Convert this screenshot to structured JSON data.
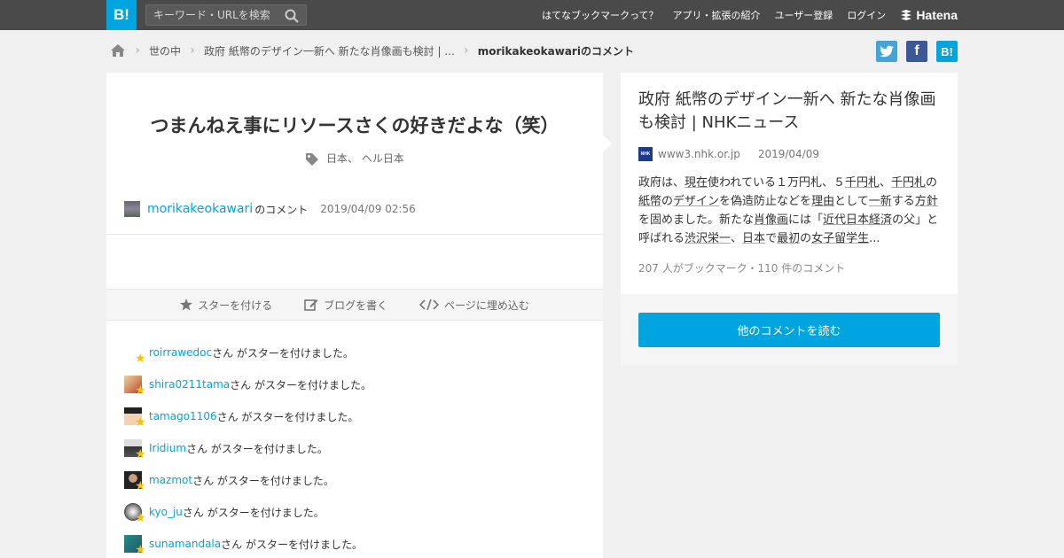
{
  "header": {
    "logo": "B!",
    "search_placeholder": "キーワード・URLを検索",
    "nav": [
      "はてなブックマークって？",
      "アプリ・拡張の紹介",
      "ユーザー登録",
      "ログイン"
    ],
    "brand": "Hatena"
  },
  "breadcrumb": {
    "items": [
      "世の中",
      "政府 紙幣のデザイン一新へ 新たな肖像画も検討 | ..."
    ],
    "current": "morikakeokawariのコメント"
  },
  "share": {
    "twitter": "t",
    "facebook": "f",
    "hatena": "B!"
  },
  "comment": {
    "text": "つまんねえ事にリソースさくの好きだよな（笑）",
    "tags": "日本、 ヘル日本",
    "user": "morikakeokawari",
    "user_suffix": "のコメント",
    "date": "2019/04/09 02:56"
  },
  "actions": [
    "スターを付ける",
    "ブログを書く",
    "ページに埋め込む"
  ],
  "stars": {
    "suffix": "さん がスターを付けました。",
    "users": [
      "roirrawedoc",
      "shira0211tama",
      "tamago1106",
      "Iridium",
      "mazmot",
      "kyo_ju",
      "sunamandala"
    ]
  },
  "entry": {
    "title": "政府 紙幣のデザイン一新へ 新たな肖像画も検討 | NHKニュース",
    "favicon": "NHK",
    "domain": "www3.nhk.or.jp",
    "date": "2019/04/09",
    "summary": {
      "s1": "政府は、",
      "k1": "現在",
      "s2": "使われている１万円札、５",
      "k2": "千円札",
      "s3": "、",
      "k3": "千円札",
      "s4": "の",
      "k4": "紙幣",
      "s5": "の",
      "k5": "デザイン",
      "s6": "を偽造防止などを",
      "k6": "理由",
      "s7": "として",
      "k7": "一新",
      "s8": "する",
      "k8": "方針",
      "s9": "を固めました。新たな",
      "k9": "肖像画",
      "s10": "には「",
      "k10": "近代日本経済",
      "s11": "の父」と呼ばれる",
      "k11": "渋沢栄一",
      "s12": "、",
      "k12": "日本",
      "s13": "で",
      "k13": "最初",
      "s14": "の",
      "k14": "女子留学生",
      "s15": "..."
    },
    "counts": "207 人がブックマーク・110 件のコメント",
    "read_button": "他のコメントを読む"
  },
  "colors": {
    "accent": "#00a4de",
    "topbar": "#4a4a4a",
    "star": "#f3c300"
  }
}
